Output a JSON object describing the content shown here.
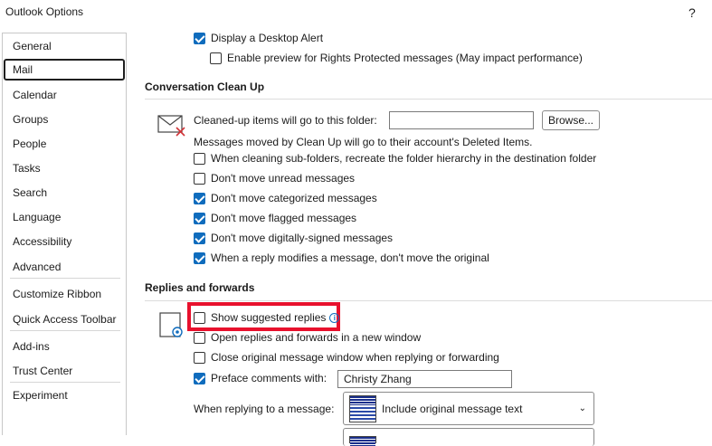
{
  "window": {
    "title": "Outlook Options",
    "help": "?"
  },
  "sidebar": {
    "items": [
      {
        "label": "General"
      },
      {
        "label": "Mail"
      },
      {
        "label": "Calendar"
      },
      {
        "label": "Groups"
      },
      {
        "label": "People"
      },
      {
        "label": "Tasks"
      },
      {
        "label": "Search"
      },
      {
        "label": "Language"
      },
      {
        "label": "Accessibility"
      },
      {
        "label": "Advanced"
      },
      {
        "label": "Customize Ribbon"
      },
      {
        "label": "Quick Access Toolbar"
      },
      {
        "label": "Add-ins"
      },
      {
        "label": "Trust Center"
      },
      {
        "label": "Experiment"
      }
    ],
    "selected": "Mail"
  },
  "top_options": {
    "desktop_alert": "Display a Desktop Alert",
    "rights_preview": "Enable preview for Rights Protected messages (May impact performance)"
  },
  "cleanup": {
    "title": "Conversation Clean Up",
    "folder_label": "Cleaned-up items will go to this folder:",
    "folder_value": "",
    "browse": "Browse...",
    "info": "Messages moved by Clean Up will go to their account's Deleted Items.",
    "options": [
      {
        "label": "When cleaning sub-folders, recreate the folder hierarchy in the destination folder",
        "checked": false
      },
      {
        "label": "Don't move unread messages",
        "checked": false
      },
      {
        "label": "Don't move categorized messages",
        "checked": true
      },
      {
        "label": "Don't move flagged messages",
        "checked": true
      },
      {
        "label": "Don't move digitally-signed messages",
        "checked": true
      },
      {
        "label": "When a reply modifies a message, don't move the original",
        "checked": true
      }
    ]
  },
  "replies": {
    "title": "Replies and forwards",
    "suggested": "Show suggested replies",
    "new_window": "Open replies and forwards in a new window",
    "close_original": "Close original message window when replying or forwarding",
    "preface": "Preface comments with:",
    "preface_value": "Christy Zhang",
    "when_replying": "When replying to a message:",
    "reply_option": "Include original message text"
  },
  "colors": {
    "accent": "#0f6cbd",
    "highlight": "#e8112d"
  }
}
